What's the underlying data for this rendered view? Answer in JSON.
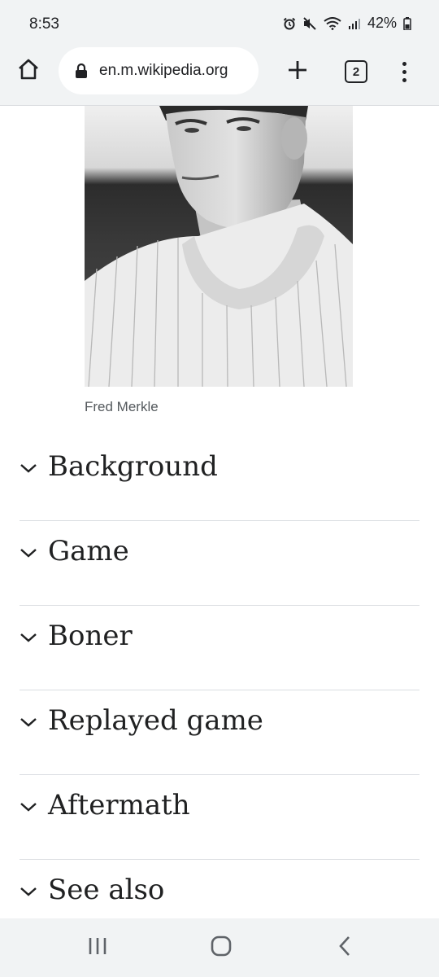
{
  "status_bar": {
    "time": "8:53",
    "battery": "42%",
    "icons": [
      "alarm-icon",
      "mute-icon",
      "wifi-icon",
      "signal-icon",
      "battery-icon"
    ]
  },
  "browser": {
    "url": "en.m.wikipedia.org",
    "tab_count": "2",
    "icons": [
      "home-icon",
      "lock-icon",
      "plus-icon",
      "tabs-icon",
      "more-vert-icon"
    ]
  },
  "article": {
    "image_caption": "Fred Merkle",
    "sections": [
      {
        "title": "Background"
      },
      {
        "title": "Game"
      },
      {
        "title": "Boner"
      },
      {
        "title": "Replayed game"
      },
      {
        "title": "Aftermath"
      },
      {
        "title": "See also"
      }
    ]
  },
  "nav_bar": {
    "icons": [
      "recents-icon",
      "home-circle-icon",
      "back-icon"
    ]
  },
  "colors": {
    "chrome_bg": "#f1f3f4",
    "text": "#202122",
    "caption": "#54595d",
    "divider": "#dadde1"
  }
}
